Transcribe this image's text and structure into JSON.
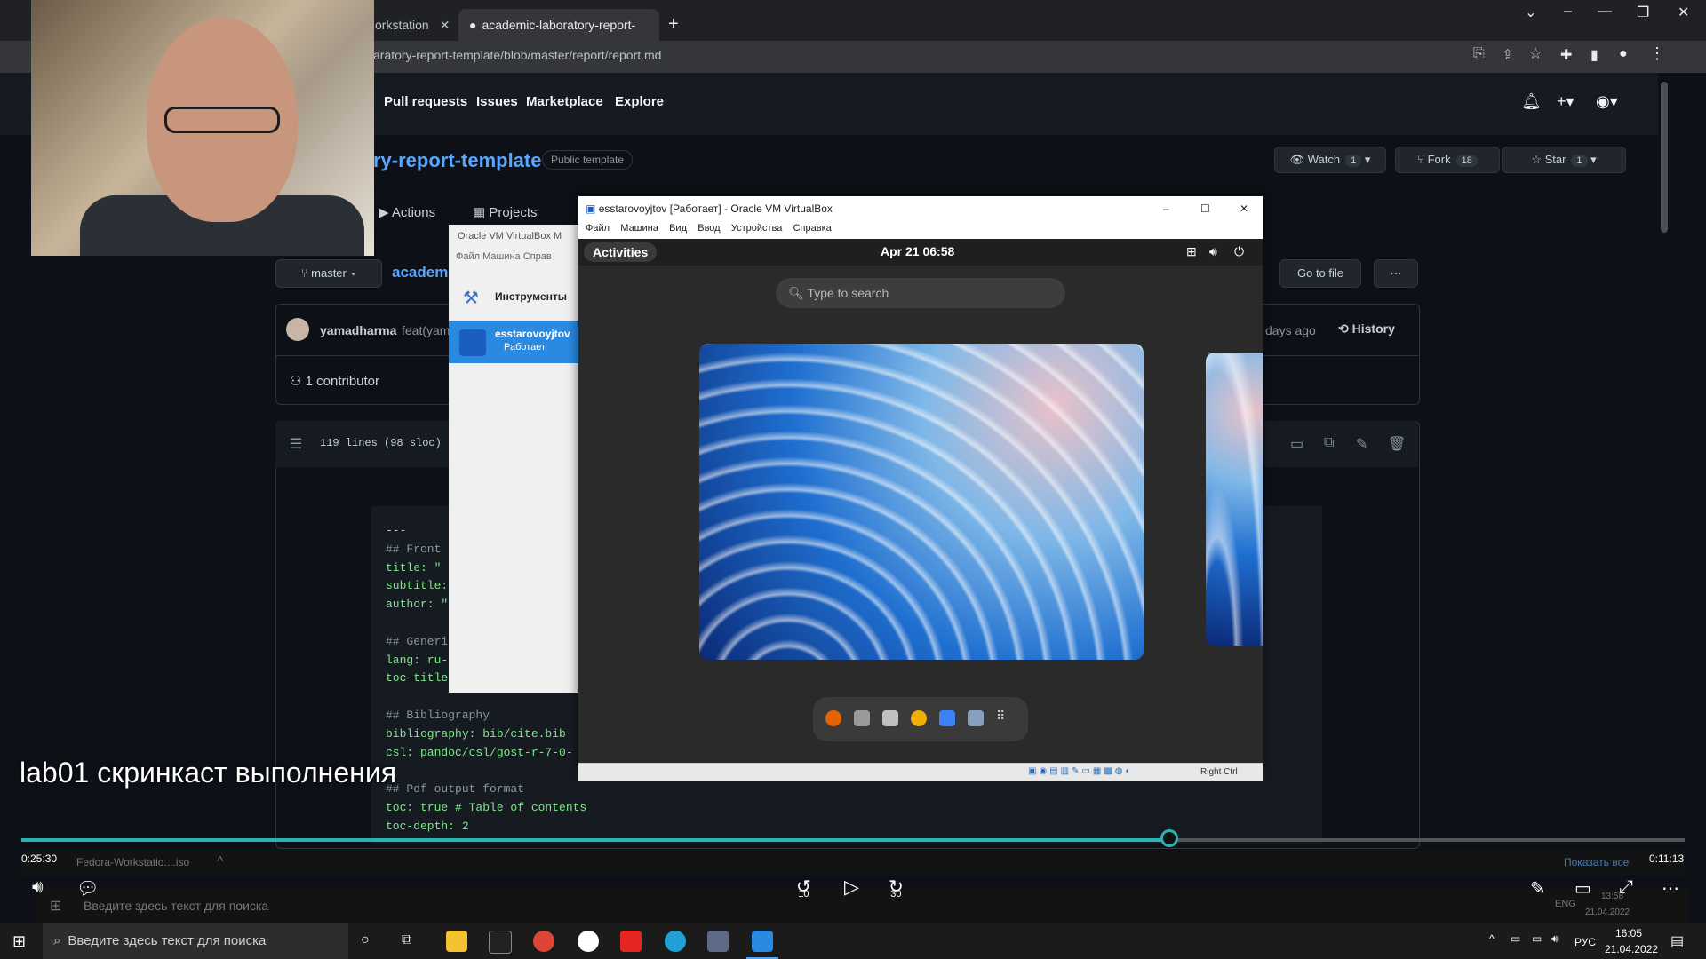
{
  "browser": {
    "tabs": [
      {
        "label": "orkstation"
      },
      {
        "label": "academic-laboratory-report-tem"
      }
    ],
    "url": "aratory-report-template/blob/master/report/report.md"
  },
  "github": {
    "nav": [
      "Pull requests",
      "Issues",
      "Marketplace",
      "Explore"
    ],
    "repo_name": "ry-report-template",
    "repo_badge": "Public template",
    "watch": {
      "label": "Watch",
      "count": "1"
    },
    "fork": {
      "label": "Fork",
      "count": "18"
    },
    "star": {
      "label": "Star",
      "count": "1"
    },
    "repo_tabs": [
      "Actions",
      "Projects"
    ],
    "branch": "master",
    "path_start": "academ",
    "go_to_file": "Go to file",
    "more": "···",
    "commit_author": "yamadharma",
    "commit_msg": "feat(yam",
    "commit_age": "days ago",
    "history": "History",
    "contributors": "1 contributor",
    "file_info": "119 lines (98 sloc)",
    "code_lines": [
      {
        "text": "---",
        "color": "#c9d1d9"
      },
      {
        "text": "## Front",
        "color": "#8b949e"
      },
      {
        "text": "title: \"",
        "color": "#7ee787"
      },
      {
        "text": "subtitle:",
        "color": "#7ee787"
      },
      {
        "text": "author: \"",
        "color": "#7ee787"
      },
      {
        "text": "",
        "color": "#c9d1d9"
      },
      {
        "text": "## Generi",
        "color": "#8b949e"
      },
      {
        "text": "lang: ru-",
        "color": "#7ee787"
      },
      {
        "text": "toc-title",
        "color": "#7ee787"
      },
      {
        "text": "",
        "color": "#c9d1d9"
      },
      {
        "text": "## Bibliography",
        "color": "#8b949e"
      },
      {
        "text": "bibliography: bib/cite.bib",
        "color": "#7ee787"
      },
      {
        "text": "csl: pandoc/csl/gost-r-7-0-",
        "color": "#7ee787"
      },
      {
        "text": "",
        "color": "#c9d1d9"
      },
      {
        "text": "## Pdf output format",
        "color": "#8b949e"
      },
      {
        "text": "toc: true # Table of contents",
        "color": "#7ee787"
      },
      {
        "text": "toc-depth: 2",
        "color": "#7ee787"
      }
    ]
  },
  "vbox_manager": {
    "title": "Oracle VM VirtualBox М",
    "menu": "Файл   Машина   Справ",
    "tools": "Инструменты",
    "vm_name": "esstarovoyjtov",
    "vm_state": "Работает"
  },
  "vm_window": {
    "title": "esstarovoyjtov [Работает] - Oracle VM VirtualBox",
    "menu": [
      "Файл",
      "Машина",
      "Вид",
      "Ввод",
      "Устройства",
      "Справка"
    ],
    "status_right": "Right Ctrl"
  },
  "gnome": {
    "activities": "Activities",
    "clock": "Apr 21  06:58",
    "search_placeholder": "Type to search"
  },
  "caption": "lab01 скринкаст выполнения",
  "player": {
    "elapsed": "0:25:30",
    "remaining": "0:11:13",
    "progress": 0.69,
    "skip_back": "10",
    "skip_forward": "30",
    "downloads_item": "Fedora-Workstatio....iso",
    "show_all": "Показать все"
  },
  "inner_taskbar": {
    "search": "Введите здесь текст для поиска",
    "lang": "ENG",
    "time": "13:58",
    "date": "21.04.2022"
  },
  "taskbar": {
    "search": "Введите здесь текст для поиска",
    "lang": "РУС",
    "time": "16:05",
    "date": "21.04.2022"
  },
  "colors": {
    "accent": "#2bb3b3",
    "link": "#58a6ff",
    "gh_bg": "#0d1117"
  }
}
